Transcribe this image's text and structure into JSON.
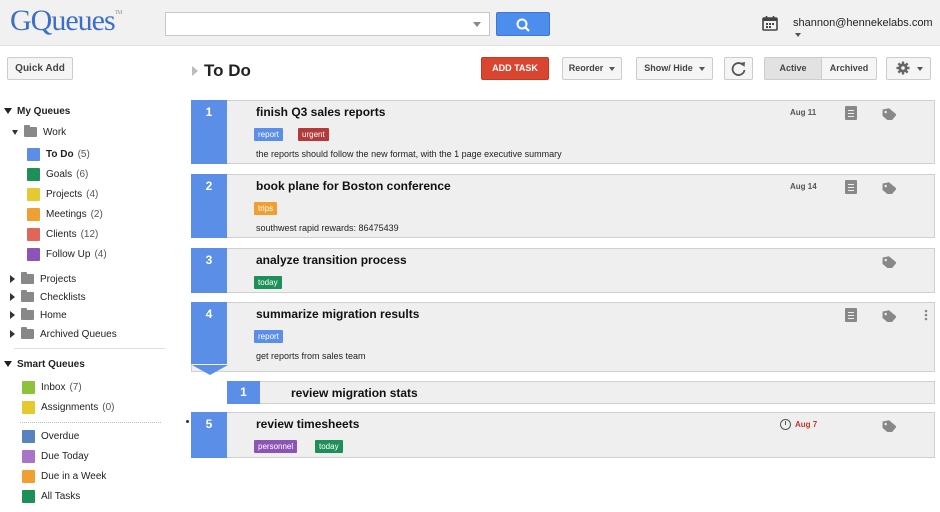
{
  "header": {
    "logo": "GQueues",
    "logo_tm": "TM",
    "search_placeholder": "",
    "user_email": "shannon@hennekelabs.com"
  },
  "toolbar": {
    "quick_add": "Quick Add",
    "page_title": "To Do",
    "add_task": "ADD TASK",
    "reorder": "Reorder",
    "show_hide": "Show/ Hide",
    "active": "Active",
    "archived": "Archived"
  },
  "sidebar": {
    "my_queues": "My Queues",
    "work": "Work",
    "work_queues": [
      {
        "label": "To Do",
        "count": "(5)",
        "color": "#5b8ee6",
        "bold": true
      },
      {
        "label": "Goals",
        "count": "(6)",
        "color": "#1f8f5a"
      },
      {
        "label": "Projects",
        "count": "(4)",
        "color": "#e6c930"
      },
      {
        "label": "Meetings",
        "count": "(2)",
        "color": "#f0a030"
      },
      {
        "label": "Clients",
        "count": "(12)",
        "color": "#e0665a"
      },
      {
        "label": "Follow Up",
        "count": "(4)",
        "color": "#8d54b8"
      }
    ],
    "folders": [
      "Projects",
      "Checklists",
      "Home",
      "Archived Queues"
    ],
    "smart_queues": "Smart Queues",
    "smart_top": [
      {
        "label": "Inbox",
        "count": "(7)",
        "color": "#8dc33a"
      },
      {
        "label": "Assignments",
        "count": "(0)",
        "color": "#e6c930"
      }
    ],
    "smart_bottom": [
      {
        "label": "Overdue",
        "color": "#5b82c0"
      },
      {
        "label": "Due Today",
        "color": "#a675c8"
      },
      {
        "label": "Due in a Week",
        "color": "#f0a030"
      },
      {
        "label": "All Tasks",
        "color": "#1f8f5a"
      }
    ]
  },
  "tasks": [
    {
      "num": "1",
      "title": "finish Q3 sales reports",
      "date": "Aug 11",
      "note": "the reports should follow the new format, with the 1 page executive summary",
      "tags": [
        {
          "label": "report",
          "color": "#5b8ee6"
        },
        {
          "label": "urgent",
          "color": "#b43a3a"
        }
      ]
    },
    {
      "num": "2",
      "title": "book plane for Boston conference",
      "date": "Aug 14",
      "note": "southwest rapid rewards: 86475439",
      "tags": [
        {
          "label": "trips",
          "color": "#f0a030"
        }
      ]
    },
    {
      "num": "3",
      "title": "analyze transition process",
      "date": "",
      "note": "",
      "tags": [
        {
          "label": "today",
          "color": "#1f8f5a"
        }
      ]
    },
    {
      "num": "4",
      "title": "summarize migration results",
      "date": "",
      "note": "get reports from sales team",
      "tags": [
        {
          "label": "report",
          "color": "#5b8ee6"
        }
      ]
    },
    {
      "num": "5",
      "title": "review timesheets",
      "date": "Aug 7",
      "date_color": "#c0392b",
      "note": "",
      "tags": [
        {
          "label": "personnel",
          "color": "#8d54b8"
        },
        {
          "label": "today",
          "color": "#1f8f5a"
        }
      ]
    }
  ],
  "subtask": {
    "num": "1",
    "title": "review migration stats"
  }
}
